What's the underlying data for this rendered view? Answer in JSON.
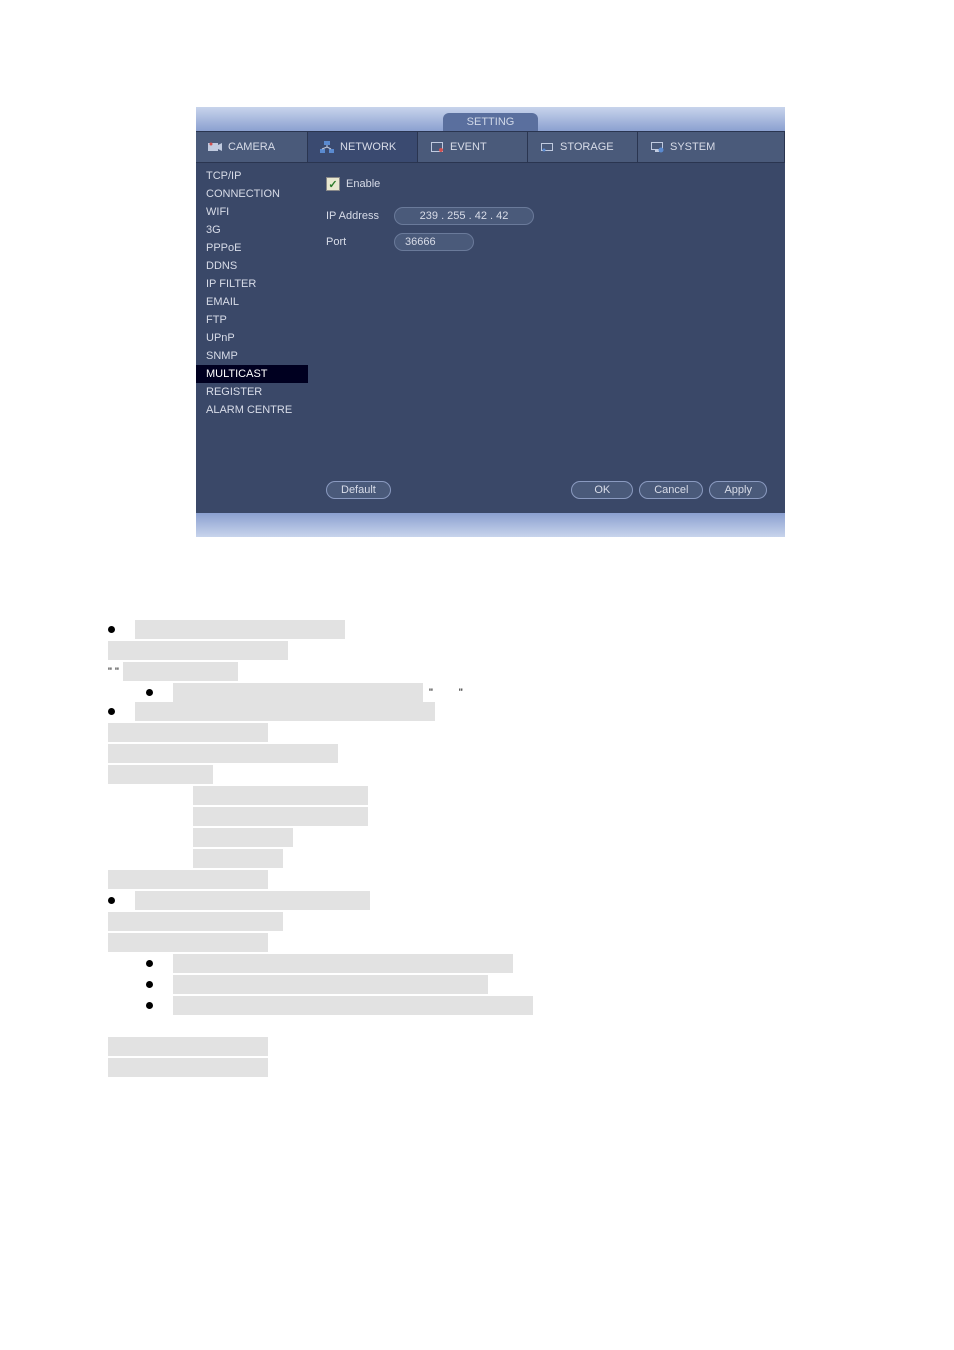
{
  "window": {
    "title": "SETTING"
  },
  "tabs": {
    "camera": "CAMERA",
    "network": "NETWORK",
    "event": "EVENT",
    "storage": "STORAGE",
    "system": "SYSTEM"
  },
  "sidebar": {
    "items": [
      "TCP/IP",
      "CONNECTION",
      "WIFI",
      "3G",
      "PPPoE",
      "DDNS",
      "IP FILTER",
      "EMAIL",
      "FTP",
      "UPnP",
      "SNMP",
      "MULTICAST",
      "REGISTER",
      "ALARM CENTRE"
    ],
    "active_index": 11
  },
  "form": {
    "enable_label": "Enable",
    "enable_checked": true,
    "ip_label": "IP Address",
    "ip_value": "239 . 255 .  42 .  42",
    "port_label": "Port",
    "port_value": "36666"
  },
  "buttons": {
    "default": "Default",
    "ok": "OK",
    "cancel": "Cancel",
    "apply": "Apply"
  }
}
